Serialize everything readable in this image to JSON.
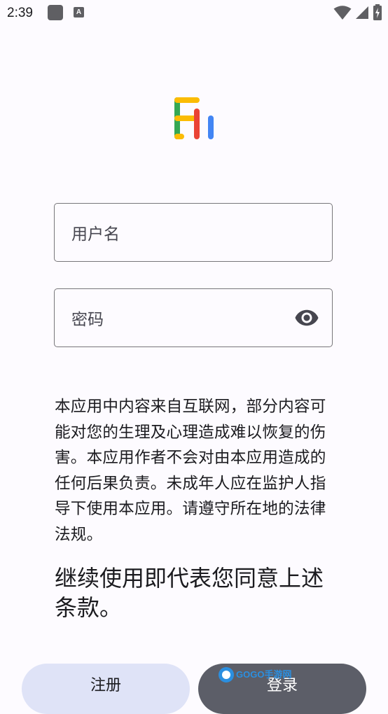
{
  "status_bar": {
    "time": "2:39",
    "notif_letter": "A"
  },
  "form": {
    "username_placeholder": "用户名",
    "password_placeholder": "密码"
  },
  "disclaimer": "本应用中内容来自互联网，部分内容可能对您的生理及心理造成难以恢复的伤害。本应用作者不会对由本应用造成的任何后果负责。未成年人应在监护人指导下使用本应用。请遵守所在地的法律法规。",
  "consent": "继续使用即代表您同意上述条款。",
  "buttons": {
    "register": "注册",
    "login": "登录"
  },
  "watermark": "GOGO手游网",
  "colors": {
    "background": "#fdfbff",
    "register_bg": "#dfe3f7",
    "login_bg": "#5c5e68",
    "logo_green": "#34a853",
    "logo_yellow": "#fbbc04",
    "logo_red": "#ea4335",
    "logo_blue": "#4285f4"
  }
}
